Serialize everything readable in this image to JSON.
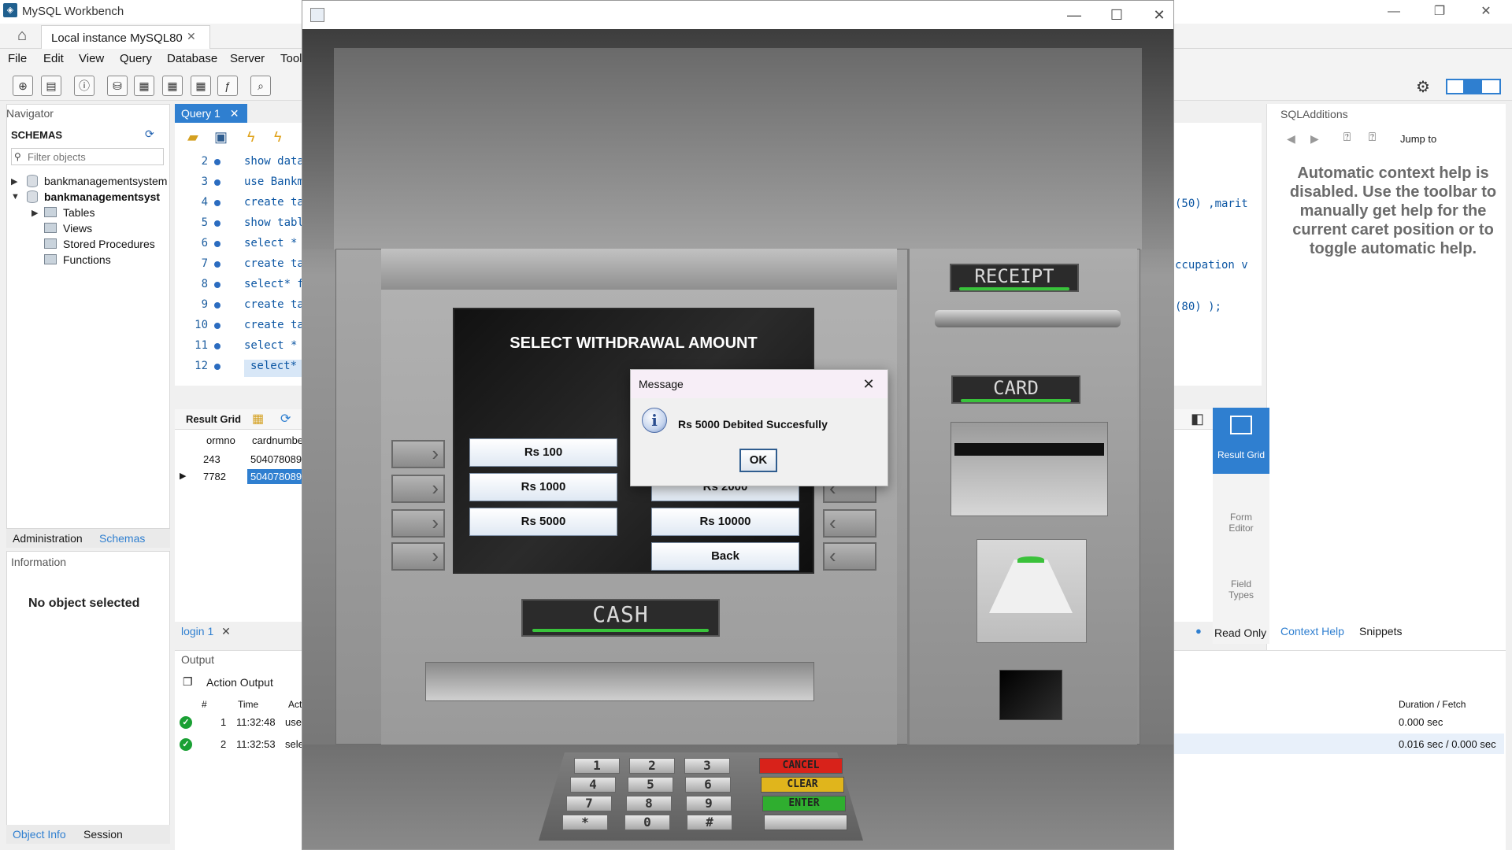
{
  "workbench": {
    "title": "MySQL Workbench",
    "connection_tab": "Local instance MySQL80",
    "menu": [
      "File",
      "Edit",
      "View",
      "Query",
      "Database",
      "Server",
      "Tool"
    ],
    "navigator": {
      "header": "Navigator",
      "schemas_label": "SCHEMAS",
      "filter_placeholder": "Filter objects",
      "tree": [
        "bankmanagementsystem",
        "bankmanagementsyst",
        "Tables",
        "Views",
        "Stored Procedures",
        "Functions"
      ]
    },
    "admin_tabs": [
      "Administration",
      "Schemas"
    ],
    "information_header": "Information",
    "no_object": "No object selected",
    "bottom_tabs": [
      "Object Info",
      "Session"
    ],
    "query_tab": "Query 1",
    "editor_lines": [
      {
        "no": "2",
        "code": "show data"
      },
      {
        "no": "3",
        "code": "use Bankm"
      },
      {
        "no": "4",
        "code": "create ta"
      },
      {
        "no": "5",
        "code": "show tabl"
      },
      {
        "no": "6",
        "code": "select *"
      },
      {
        "no": "7",
        "code": "create ta"
      },
      {
        "no": "8",
        "code": "select* f"
      },
      {
        "no": "9",
        "code": "create ta"
      },
      {
        "no": "10",
        "code": "create ta"
      },
      {
        "no": "11",
        "code": "select *"
      },
      {
        "no": "12",
        "code": "select*"
      }
    ],
    "editor_right_fragments": [
      "(50) ,marit",
      "ccupation v",
      "(80) );"
    ],
    "result_grid_label": "Result Grid",
    "grid_headers": [
      "ormno",
      "cardnumbe"
    ],
    "grid_rows": [
      [
        "243",
        "504078089"
      ],
      [
        "7782",
        "504078089"
      ]
    ],
    "login_tab": "login 1",
    "output_header": "Output",
    "action_output": "Action Output",
    "output_columns": [
      "#",
      "Time",
      "Act",
      "Duration / Fetch"
    ],
    "output_rows": [
      {
        "no": "1",
        "time": "11:32:48",
        "action": "use",
        "duration": "0.000 sec"
      },
      {
        "no": "2",
        "time": "11:32:53",
        "action": "sele",
        "duration": "0.016 sec / 0.000 sec"
      }
    ],
    "sql_additions": {
      "header": "SQLAdditions",
      "jump_to": "Jump to",
      "help_text": "Automatic context help is disabled. Use the toolbar to manually get help for the current caret position or to toggle automatic help.",
      "tabs": [
        "Context Help",
        "Snippets"
      ]
    },
    "side_buttons": [
      "Result Grid",
      "Form Editor",
      "Field Types"
    ],
    "read_only": "Read Only"
  },
  "atm": {
    "screen_title": "SELECT WITHDRAWAL AMOUNT",
    "buttons_left": [
      "Rs 100",
      "Rs 1000",
      "Rs 5000"
    ],
    "buttons_right": [
      "Rs 2000",
      "Rs 10000",
      "Back"
    ],
    "receipt_label": "RECEIPT",
    "card_label": "CARD",
    "cash_label": "CASH",
    "keypad": [
      "1",
      "2",
      "3",
      "4",
      "5",
      "6",
      "7",
      "8",
      "9",
      "*",
      "0",
      "#"
    ],
    "function_keys": [
      {
        "label": "CANCEL",
        "color": "#d8221a"
      },
      {
        "label": "CLEAR",
        "color": "#e0b51c"
      },
      {
        "label": "ENTER",
        "color": "#2fae2f"
      }
    ]
  },
  "dialog": {
    "title": "Message",
    "message": "Rs 5000 Debited Succesfully",
    "ok_label": "OK"
  },
  "colors": {
    "accent": "#2f7fd0",
    "indicator_green": "#39c33b"
  }
}
